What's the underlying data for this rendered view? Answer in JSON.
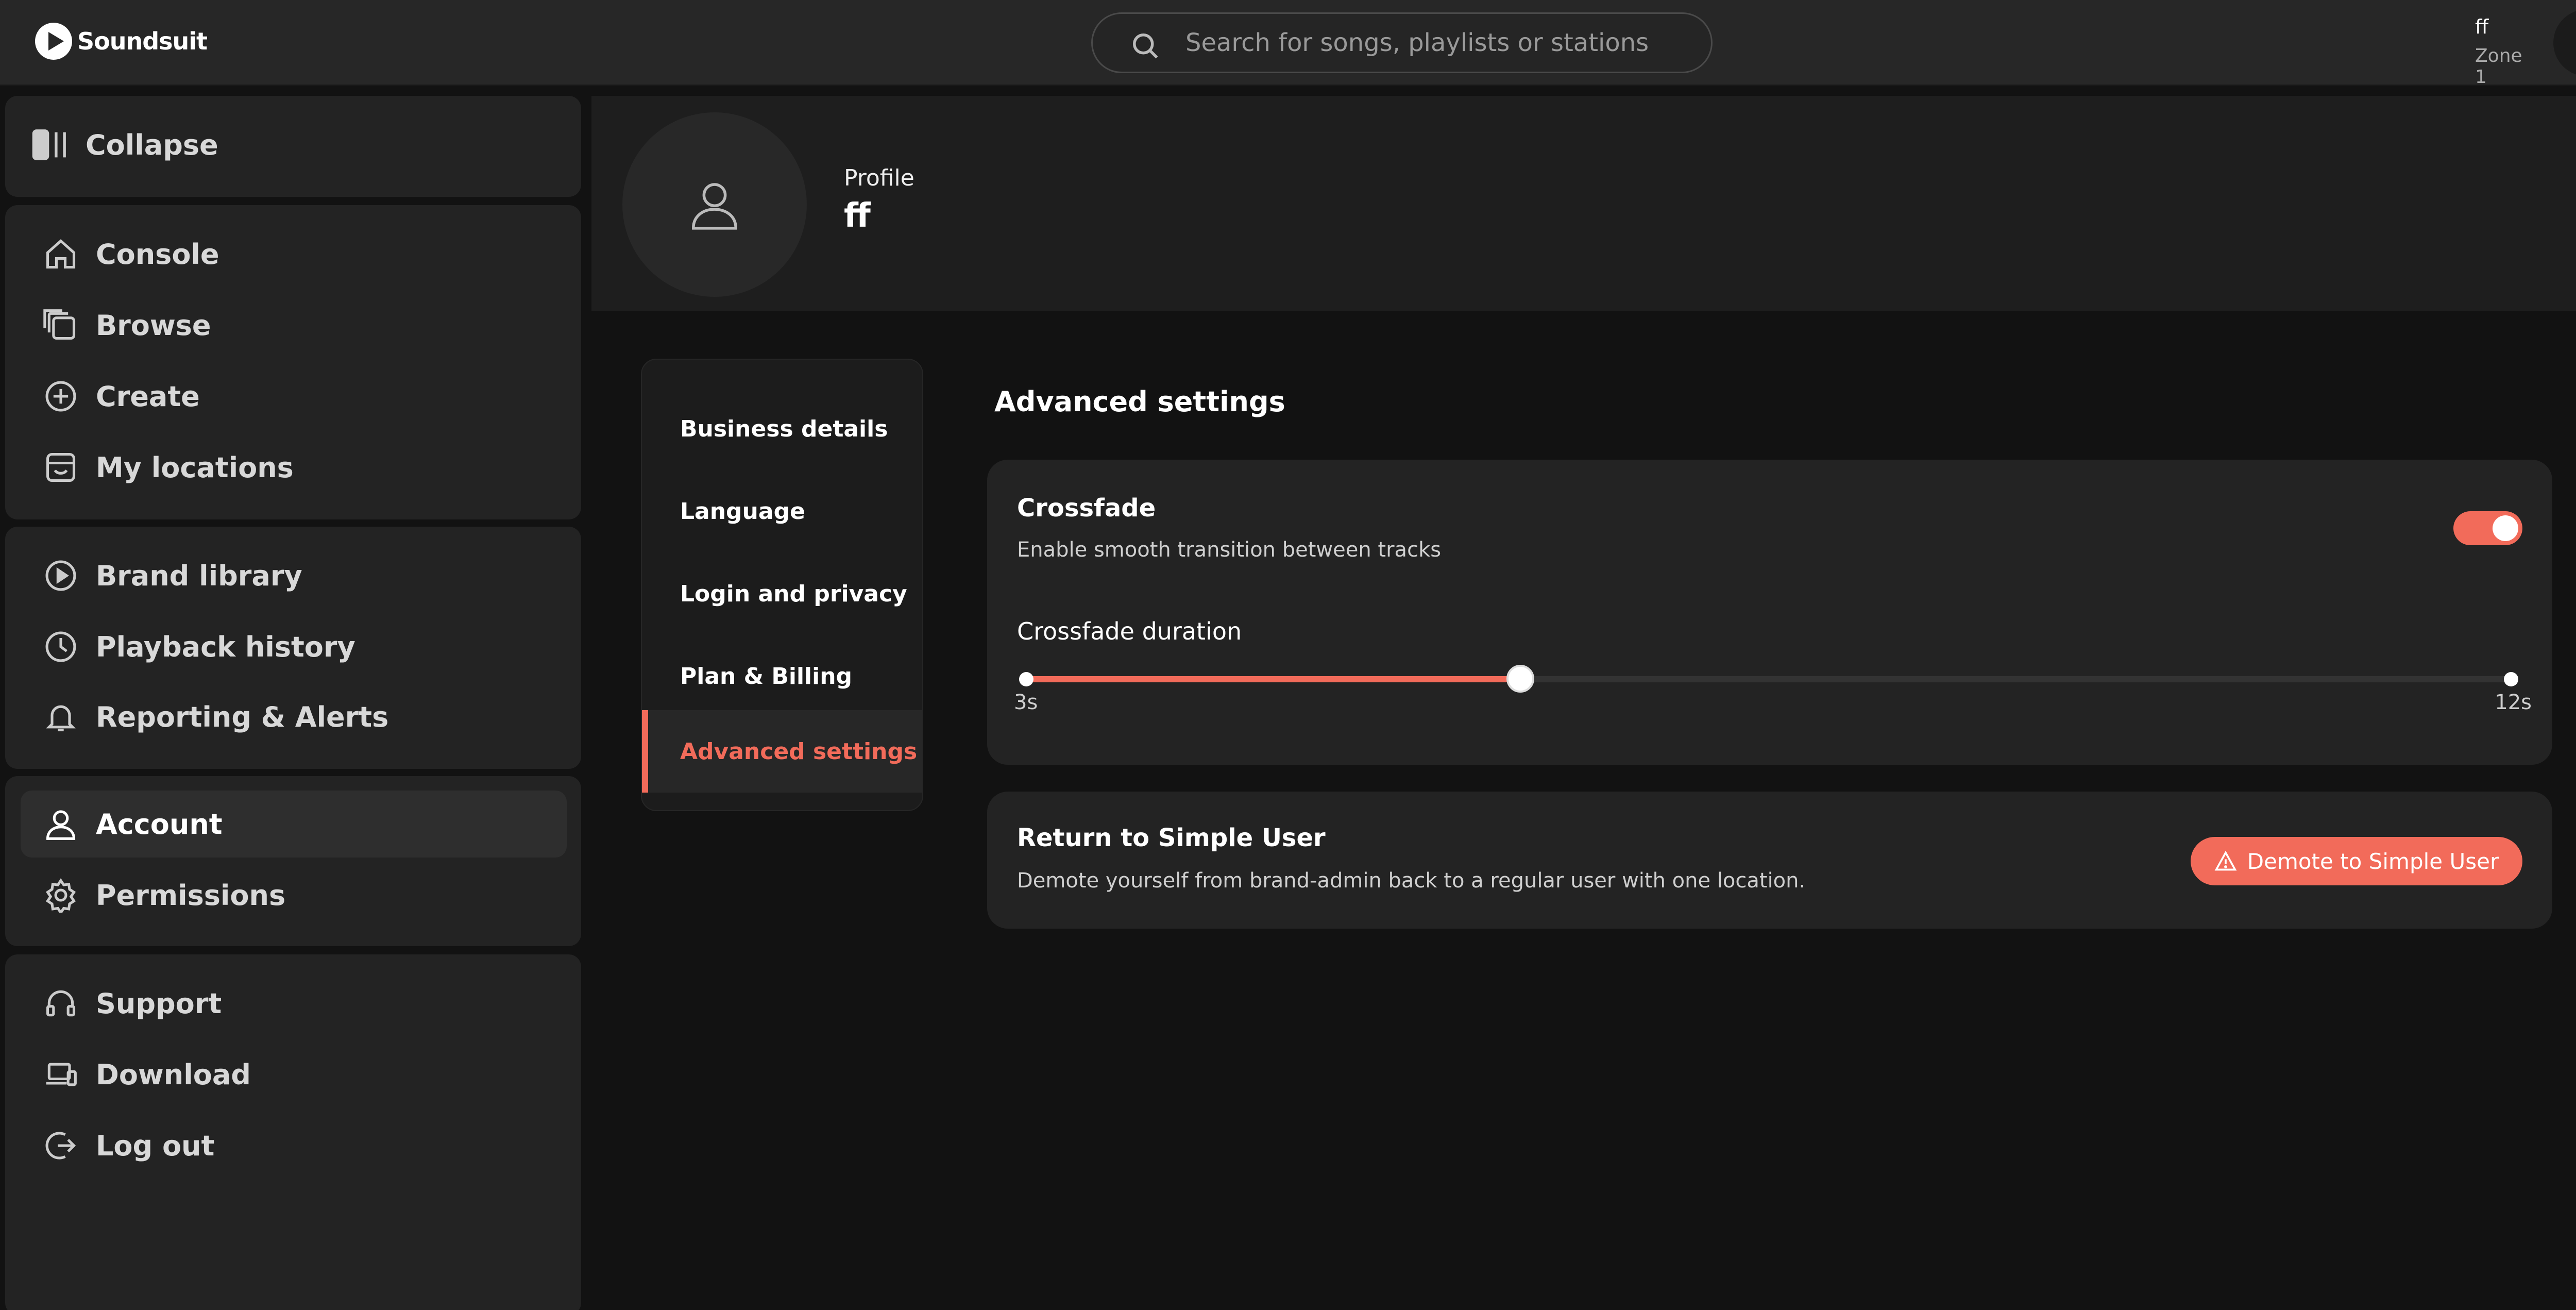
{
  "app": {
    "brand": "Soundsuit",
    "accent": "#f26b5a"
  },
  "search": {
    "placeholder": "Search for songs, playlists or stations"
  },
  "user": {
    "name": "ff",
    "zone": "Zone 1"
  },
  "sidebar": {
    "collapse": "Collapse",
    "items": [
      {
        "label": "Console",
        "icon": "home-icon"
      },
      {
        "label": "Browse",
        "icon": "browse-icon"
      },
      {
        "label": "Create",
        "icon": "plus-circle-icon"
      },
      {
        "label": "My locations",
        "icon": "store-icon"
      },
      {
        "label": "Brand library",
        "icon": "play-circle-icon"
      },
      {
        "label": "Playback history",
        "icon": "clock-icon"
      },
      {
        "label": "Reporting & Alerts",
        "icon": "bell-icon"
      },
      {
        "label": "Account",
        "icon": "user-icon",
        "active": true
      },
      {
        "label": "Permissions",
        "icon": "gear-icon"
      },
      {
        "label": "Support",
        "icon": "headset-icon"
      },
      {
        "label": "Download",
        "icon": "devices-icon"
      },
      {
        "label": "Log out",
        "icon": "logout-icon"
      }
    ]
  },
  "profile": {
    "label": "Profile",
    "name": "ff"
  },
  "settings_menu": [
    {
      "label": "Business details"
    },
    {
      "label": "Language"
    },
    {
      "label": "Login and privacy"
    },
    {
      "label": "Plan & Billing"
    },
    {
      "label": "Advanced settings",
      "active": true
    }
  ],
  "advanced": {
    "title": "Advanced settings",
    "crossfade": {
      "title": "Crossfade",
      "desc": "Enable smooth transition between tracks",
      "enabled": true,
      "duration_label": "Crossfade duration",
      "min_label": "3s",
      "max_label": "12s",
      "min": 3,
      "max": 12,
      "value": 6
    },
    "simple_user": {
      "title": "Return to Simple User",
      "desc": "Demote yourself from brand-admin back to a regular user with one location.",
      "button": "Demote to Simple User"
    }
  }
}
